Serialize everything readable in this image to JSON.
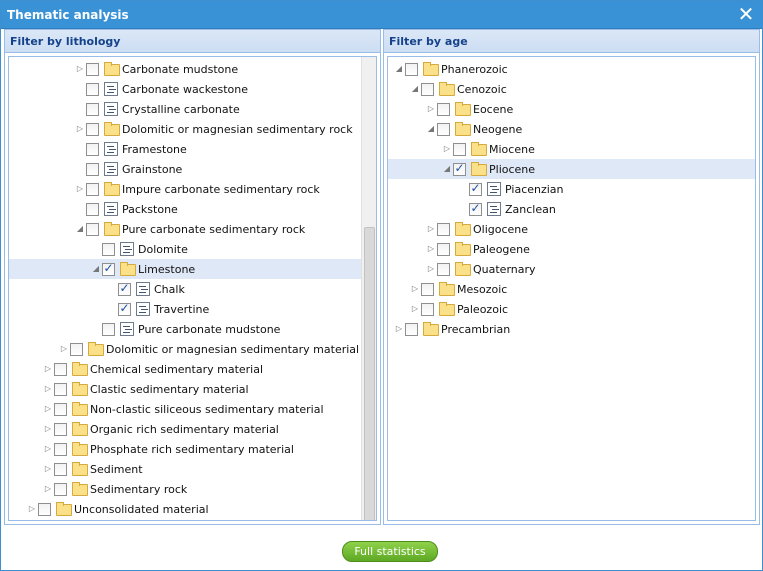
{
  "window": {
    "title": "Thematic analysis",
    "close_glyph": "✕"
  },
  "left_panel": {
    "title": "Filter by lithology",
    "items": [
      {
        "label": "Carbonate mudstone",
        "level": 4,
        "type": "folder",
        "expander": "collapsed",
        "checked": false
      },
      {
        "label": "Carbonate wackestone",
        "level": 4,
        "type": "leaf",
        "expander": "none",
        "checked": false
      },
      {
        "label": "Crystalline carbonate",
        "level": 4,
        "type": "leaf",
        "expander": "none",
        "checked": false
      },
      {
        "label": "Dolomitic or magnesian sedimentary rock",
        "level": 4,
        "type": "folder",
        "expander": "collapsed",
        "checked": false
      },
      {
        "label": "Framestone",
        "level": 4,
        "type": "leaf",
        "expander": "none",
        "checked": false
      },
      {
        "label": "Grainstone",
        "level": 4,
        "type": "leaf",
        "expander": "none",
        "checked": false
      },
      {
        "label": "Impure carbonate sedimentary rock",
        "level": 4,
        "type": "folder",
        "expander": "collapsed",
        "checked": false
      },
      {
        "label": "Packstone",
        "level": 4,
        "type": "leaf",
        "expander": "none",
        "checked": false
      },
      {
        "label": "Pure carbonate sedimentary rock",
        "level": 4,
        "type": "folder",
        "expander": "expanded",
        "checked": false
      },
      {
        "label": "Dolomite",
        "level": 5,
        "type": "leaf",
        "expander": "none",
        "checked": false
      },
      {
        "label": "Limestone",
        "level": 5,
        "type": "folder",
        "expander": "expanded",
        "checked": true,
        "selected": true
      },
      {
        "label": "Chalk",
        "level": 6,
        "type": "leaf",
        "expander": "none",
        "checked": true
      },
      {
        "label": "Travertine",
        "level": 6,
        "type": "leaf",
        "expander": "none",
        "checked": true
      },
      {
        "label": "Pure carbonate mudstone",
        "level": 5,
        "type": "leaf",
        "expander": "none",
        "checked": false
      },
      {
        "label": "Dolomitic or magnesian sedimentary material",
        "level": 3,
        "type": "folder",
        "expander": "collapsed",
        "checked": false
      },
      {
        "label": "Chemical sedimentary material",
        "level": 2,
        "type": "folder",
        "expander": "collapsed",
        "checked": false
      },
      {
        "label": "Clastic sedimentary material",
        "level": 2,
        "type": "folder",
        "expander": "collapsed",
        "checked": false
      },
      {
        "label": "Non-clastic siliceous sedimentary material",
        "level": 2,
        "type": "folder",
        "expander": "collapsed",
        "checked": false
      },
      {
        "label": "Organic rich sedimentary material",
        "level": 2,
        "type": "folder",
        "expander": "collapsed",
        "checked": false
      },
      {
        "label": "Phosphate rich sedimentary material",
        "level": 2,
        "type": "folder",
        "expander": "collapsed",
        "checked": false
      },
      {
        "label": "Sediment",
        "level": 2,
        "type": "folder",
        "expander": "collapsed",
        "checked": false
      },
      {
        "label": "Sedimentary rock",
        "level": 2,
        "type": "folder",
        "expander": "collapsed",
        "checked": false
      },
      {
        "label": "Unconsolidated material",
        "level": 1,
        "type": "folder",
        "expander": "collapsed",
        "checked": false
      }
    ]
  },
  "right_panel": {
    "title": "Filter by age",
    "items": [
      {
        "label": "Phanerozoic",
        "level": 0,
        "type": "folder",
        "expander": "expanded",
        "checked": false
      },
      {
        "label": "Cenozoic",
        "level": 1,
        "type": "folder",
        "expander": "expanded",
        "checked": false
      },
      {
        "label": "Eocene",
        "level": 2,
        "type": "folder",
        "expander": "collapsed",
        "checked": false
      },
      {
        "label": "Neogene",
        "level": 2,
        "type": "folder",
        "expander": "expanded",
        "checked": false
      },
      {
        "label": "Miocene",
        "level": 3,
        "type": "folder",
        "expander": "collapsed",
        "checked": false
      },
      {
        "label": "Pliocene",
        "level": 3,
        "type": "folder",
        "expander": "expanded",
        "checked": true,
        "selected": true
      },
      {
        "label": "Piacenzian",
        "level": 4,
        "type": "leaf",
        "expander": "none",
        "checked": true
      },
      {
        "label": "Zanclean",
        "level": 4,
        "type": "leaf",
        "expander": "none",
        "checked": true
      },
      {
        "label": "Oligocene",
        "level": 2,
        "type": "folder",
        "expander": "collapsed",
        "checked": false
      },
      {
        "label": "Paleogene",
        "level": 2,
        "type": "folder",
        "expander": "collapsed",
        "checked": false
      },
      {
        "label": "Quaternary",
        "level": 2,
        "type": "folder",
        "expander": "collapsed",
        "checked": false
      },
      {
        "label": "Mesozoic",
        "level": 1,
        "type": "folder",
        "expander": "collapsed",
        "checked": false
      },
      {
        "label": "Paleozoic",
        "level": 1,
        "type": "folder",
        "expander": "collapsed",
        "checked": false
      },
      {
        "label": "Precambrian",
        "level": 0,
        "type": "folder",
        "expander": "collapsed",
        "checked": false
      }
    ]
  },
  "footer": {
    "button_label": "Full statistics"
  },
  "colors": {
    "titlebar": "#3a92d6",
    "panel_title": "#15428b",
    "selection": "#dfe8f6",
    "button": "#5ea925"
  }
}
